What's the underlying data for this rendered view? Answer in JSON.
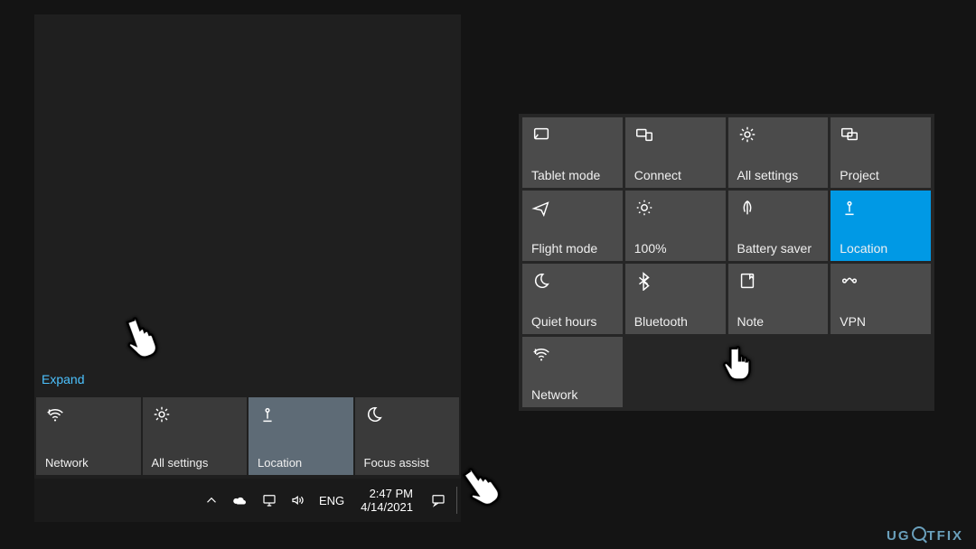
{
  "left": {
    "expand": "Expand",
    "tiles": [
      {
        "id": "network",
        "label": "Network",
        "icon": "wifi"
      },
      {
        "id": "all-settings",
        "label": "All settings",
        "icon": "gear"
      },
      {
        "id": "location",
        "label": "Location",
        "icon": "location",
        "active": true
      },
      {
        "id": "focus-assist",
        "label": "Focus assist",
        "icon": "moon"
      }
    ],
    "taskbar": {
      "lang": "ENG",
      "time": "2:47 PM",
      "date": "4/14/2021"
    }
  },
  "right": {
    "tiles": [
      {
        "id": "tablet-mode",
        "label": "Tablet mode",
        "icon": "tablet"
      },
      {
        "id": "connect",
        "label": "Connect",
        "icon": "connect"
      },
      {
        "id": "all-settings",
        "label": "All settings",
        "icon": "gear"
      },
      {
        "id": "project",
        "label": "Project",
        "icon": "project"
      },
      {
        "id": "flight-mode",
        "label": "Flight mode",
        "icon": "plane"
      },
      {
        "id": "brightness",
        "label": "100%",
        "icon": "sun"
      },
      {
        "id": "battery-saver",
        "label": "Battery saver",
        "icon": "leaf"
      },
      {
        "id": "location",
        "label": "Location",
        "icon": "location",
        "active": true
      },
      {
        "id": "quiet-hours",
        "label": "Quiet hours",
        "icon": "moon"
      },
      {
        "id": "bluetooth",
        "label": "Bluetooth",
        "icon": "bluetooth"
      },
      {
        "id": "note",
        "label": "Note",
        "icon": "note"
      },
      {
        "id": "vpn",
        "label": "VPN",
        "icon": "vpn"
      },
      {
        "id": "network",
        "label": "Network",
        "icon": "wifi"
      }
    ]
  },
  "watermark": "UGETFIX"
}
